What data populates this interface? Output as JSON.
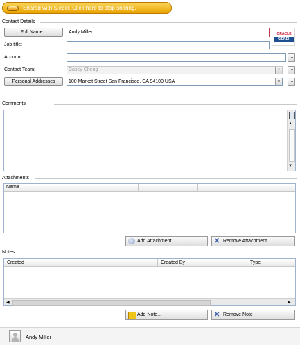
{
  "banner": {
    "text": "Shared with Siebel. Click here to stop sharing."
  },
  "contact_details": {
    "section_title": "Contact Details",
    "full_name_button": "Full Name...",
    "full_name_value": "Andy Miller",
    "job_title_label": "Job title:",
    "job_title_value": "",
    "account_label": "Account:",
    "account_value": "",
    "contact_team_label": "Contact Team:",
    "contact_team_value": "Casey Cheng",
    "personal_addresses_button": "Personal Addresses",
    "address_value": "100 Market Street San Francisco, CA 94100 USA",
    "logo_text_top": "ORACLE",
    "logo_text_bottom": "SIEBEL"
  },
  "comments": {
    "section_title": "Comments"
  },
  "attachments": {
    "section_title": "Attachments",
    "columns": [
      "Name",
      "",
      ""
    ],
    "add_button": "Add Attachment...",
    "remove_button": "Remove Attachment"
  },
  "notes": {
    "section_title": "Notes",
    "columns": [
      "Created",
      "Created By",
      "Type"
    ],
    "add_button": "Add Note...",
    "remove_button": "Remove Note"
  },
  "footer": {
    "person_name": "Andy Miller"
  },
  "colors": {
    "banner": "#f0b400",
    "accent_border": "#c0394b",
    "panel_border": "#9fb3cf"
  }
}
